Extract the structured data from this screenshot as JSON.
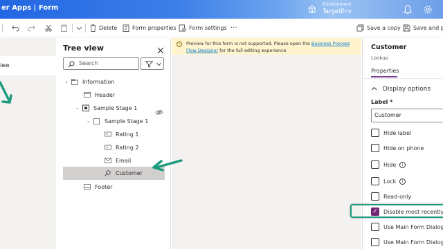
{
  "header": {
    "title": "er Apps  |  Form",
    "env_label": "Environment",
    "env_name": "TargetEnv"
  },
  "toolbar": {
    "delete": "Delete",
    "form_properties": "Form properties",
    "form_settings": "Form settings",
    "more": "···",
    "save_copy": "Save a copy",
    "save_publish": "Save and pu"
  },
  "left_nav": {
    "selected": "iew"
  },
  "tree_view": {
    "title": "Tree view",
    "search_placeholder": "Search",
    "nodes": [
      {
        "label": "Information"
      },
      {
        "label": "Header"
      },
      {
        "label": "Sample Stage 1"
      },
      {
        "label": "Sample Stage 1"
      },
      {
        "label": "Rating 1"
      },
      {
        "label": "Rating 2"
      },
      {
        "label": "Email"
      },
      {
        "label": "Customer"
      },
      {
        "label": "Footer"
      }
    ]
  },
  "banner": {
    "text_before": "Preview for this form is not supported. Please open the ",
    "link": "Business Process Flow Designer",
    "text_after": " for the full editing experience"
  },
  "properties": {
    "title": "Customer",
    "subtitle": "Lookup",
    "tab": "Properties",
    "section": "Display options",
    "label_caption": "Label *",
    "label_value": "Customer",
    "checkboxes": [
      {
        "label": "Hide label",
        "checked": false
      },
      {
        "label": "Hide on phone",
        "checked": false
      },
      {
        "label": "Hide",
        "checked": false
      },
      {
        "label": "Lock",
        "checked": false
      },
      {
        "label": "Read-only",
        "checked": false
      },
      {
        "label": "Disable most recently us",
        "checked": true
      },
      {
        "label": "Use Main Form Dialog fo",
        "checked": false
      },
      {
        "label": "Use Main Form Dialog fo",
        "checked": false
      }
    ]
  },
  "colors": {
    "accent_purple": "#742774",
    "highlight_teal": "#1c9b7e"
  }
}
